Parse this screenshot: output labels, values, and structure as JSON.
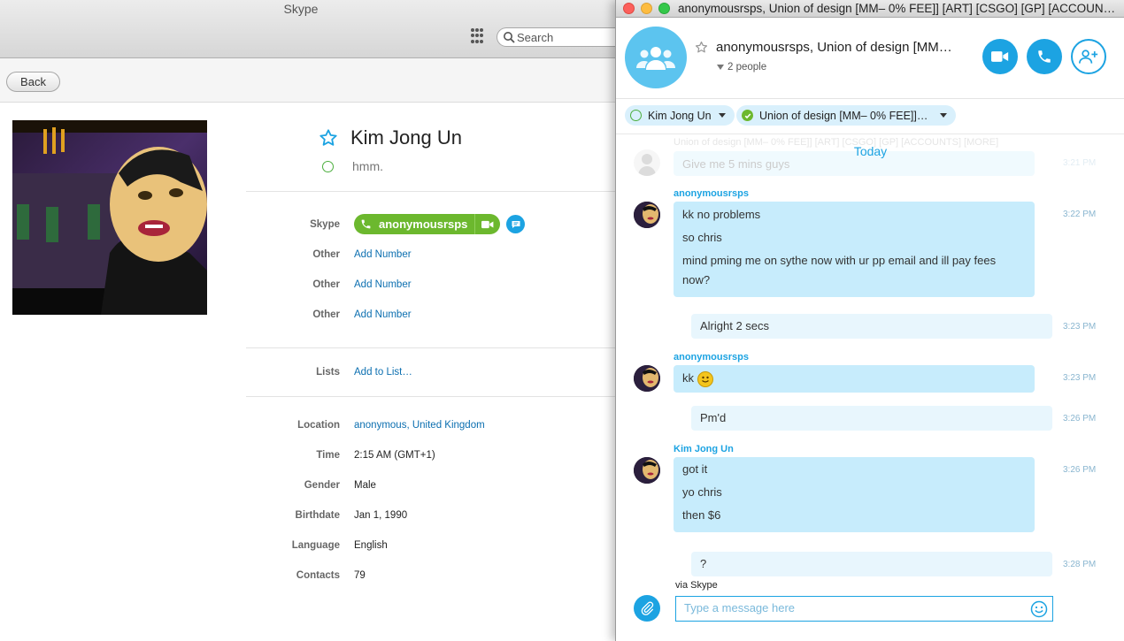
{
  "main_window": {
    "title": "Skype",
    "search_placeholder": "Search",
    "back_label": "Back"
  },
  "profile": {
    "name": "Kim Jong Un",
    "mood": "hmm.",
    "skype_label": "Skype",
    "skype_name": "anonymousrsps",
    "other_rows": [
      {
        "label": "Other",
        "value": "Add Number"
      },
      {
        "label": "Other",
        "value": "Add Number"
      },
      {
        "label": "Other",
        "value": "Add Number"
      }
    ],
    "lists_label": "Lists",
    "lists_value": "Add to List…",
    "details": [
      {
        "label": "Location",
        "value": "anonymous, United Kingdom"
      },
      {
        "label": "Time",
        "value": "2:15 AM (GMT+1)"
      },
      {
        "label": "Gender",
        "value": "Male"
      },
      {
        "label": "Birthdate",
        "value": "Jan 1, 1990"
      },
      {
        "label": "Language",
        "value": "English"
      },
      {
        "label": "Contacts",
        "value": "79"
      }
    ]
  },
  "chat": {
    "window_title": "anonymousrsps, Union of design [MM– 0% FEE]] [ART] [CSGO] [GP] [ACCOUN…",
    "conv_title": "anonymousrsps, Union of design [MM…",
    "people_count": "2 people",
    "participants": [
      "Kim Jong Un",
      "Union of design [MM– 0% FEE]]…"
    ],
    "faded_header": "Union of design [MM– 0% FEE]] [ART] [CSGO] [GP] [ACCOUNTS] [MORE]",
    "faded_message": "Give me 5 mins guys",
    "faded_time": "3:21 PM",
    "today_label": "Today",
    "messages": [
      {
        "sender": "anonymousrsps",
        "lines": [
          "kk no problems",
          "so chris",
          "mind pming me on sythe now with ur pp email and ill pay fees now?"
        ],
        "time": "3:22 PM"
      },
      {
        "sender": "",
        "lines": [
          "Alright 2 secs"
        ],
        "time": "3:23 PM"
      },
      {
        "sender": "anonymousrsps",
        "lines": [
          "kk"
        ],
        "time": "3:23 PM"
      },
      {
        "sender": "",
        "lines": [
          "Pm'd"
        ],
        "time": "3:26 PM"
      },
      {
        "sender": "Kim Jong Un",
        "lines": [
          "got it",
          "yo chris",
          "then $6"
        ],
        "time": "3:26 PM"
      },
      {
        "sender": "",
        "lines": [
          "?"
        ],
        "time": "3:28 PM"
      }
    ],
    "via_label": "via Skype",
    "compose_placeholder": "Type a message here"
  },
  "colors": {
    "skype_blue": "#1ca3e2",
    "online_green": "#6cb82e",
    "bubble_incoming": "#c7ecfc",
    "bubble_outgoing": "#e8f6fd"
  },
  "icons": [
    "dialpad-icon",
    "search-icon",
    "star-icon",
    "status-ring-icon",
    "phone-icon",
    "video-icon",
    "chat-icon",
    "group-icon",
    "add-person-icon",
    "attach-icon",
    "emoji-icon",
    "smiley-emoticon"
  ]
}
